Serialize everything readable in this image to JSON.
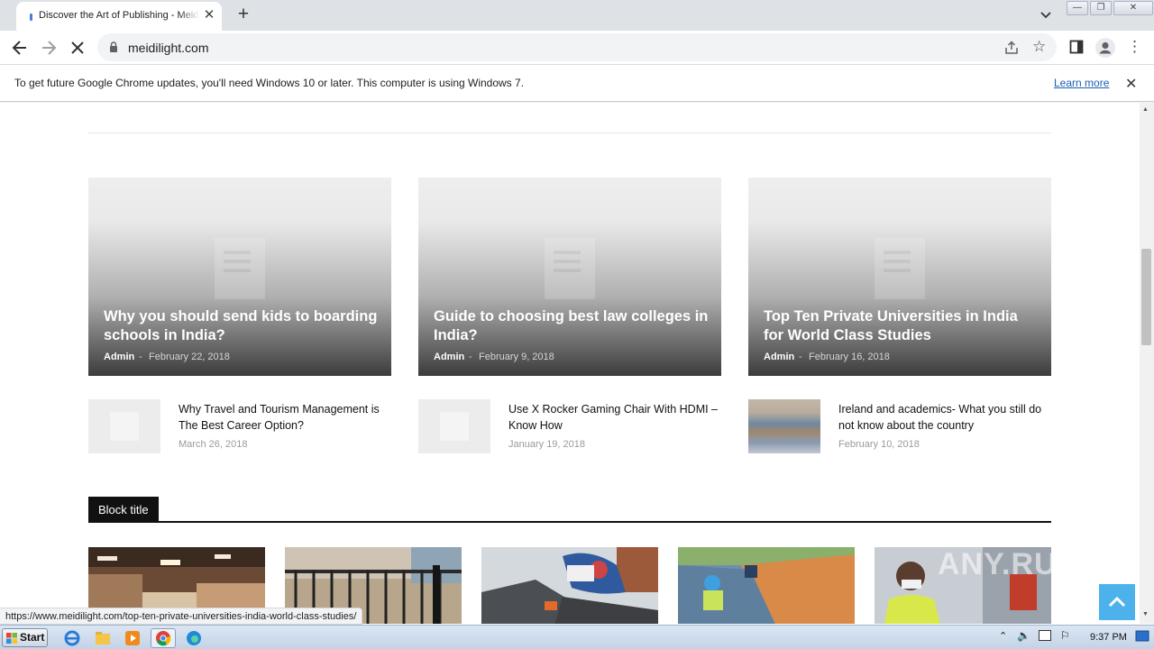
{
  "browser": {
    "tab_title": "Discover the Art of Publishing - Meidilight",
    "tab_close": "✕",
    "new_tab": "+",
    "url": "meidilight.com",
    "window_buttons": [
      "—",
      "❐",
      "✕"
    ]
  },
  "infobar": {
    "message": "To get future Google Chrome updates, you'll need Windows 10 or later. This computer is using Windows 7.",
    "learn_more": "Learn more",
    "close": "✕"
  },
  "featured": [
    {
      "title": "Why you should send kids to boarding schools in India?",
      "author": "Admin",
      "separator": "-",
      "date": "February 22, 2018"
    },
    {
      "title": "Guide to choosing best law colleges in India?",
      "author": "Admin",
      "separator": "-",
      "date": "February 9, 2018"
    },
    {
      "title": "Top Ten Private Universities in India for World Class Studies",
      "author": "Admin",
      "separator": "-",
      "date": "February 16, 2018"
    }
  ],
  "small_posts": [
    {
      "title": "Why Travel and Tourism Management is The Best Career Option?",
      "date": "March 26, 2018"
    },
    {
      "title": "Use X Rocker Gaming Chair With HDMI – Know How",
      "date": "January 19, 2018"
    },
    {
      "title": "Ireland and academics- What you still do not know about the country",
      "date": "February 10, 2018"
    }
  ],
  "block": {
    "title": "Block title"
  },
  "status_url": "https://www.meidilight.com/top-ten-private-universities-india-world-class-studies/",
  "watermark": "ANY.RUN",
  "taskbar": {
    "start": "Start",
    "clock": "9:37 PM"
  },
  "colors": {
    "accent": "#4db2ec",
    "link": "#1a5fb4",
    "block_title_bg": "#111111"
  }
}
